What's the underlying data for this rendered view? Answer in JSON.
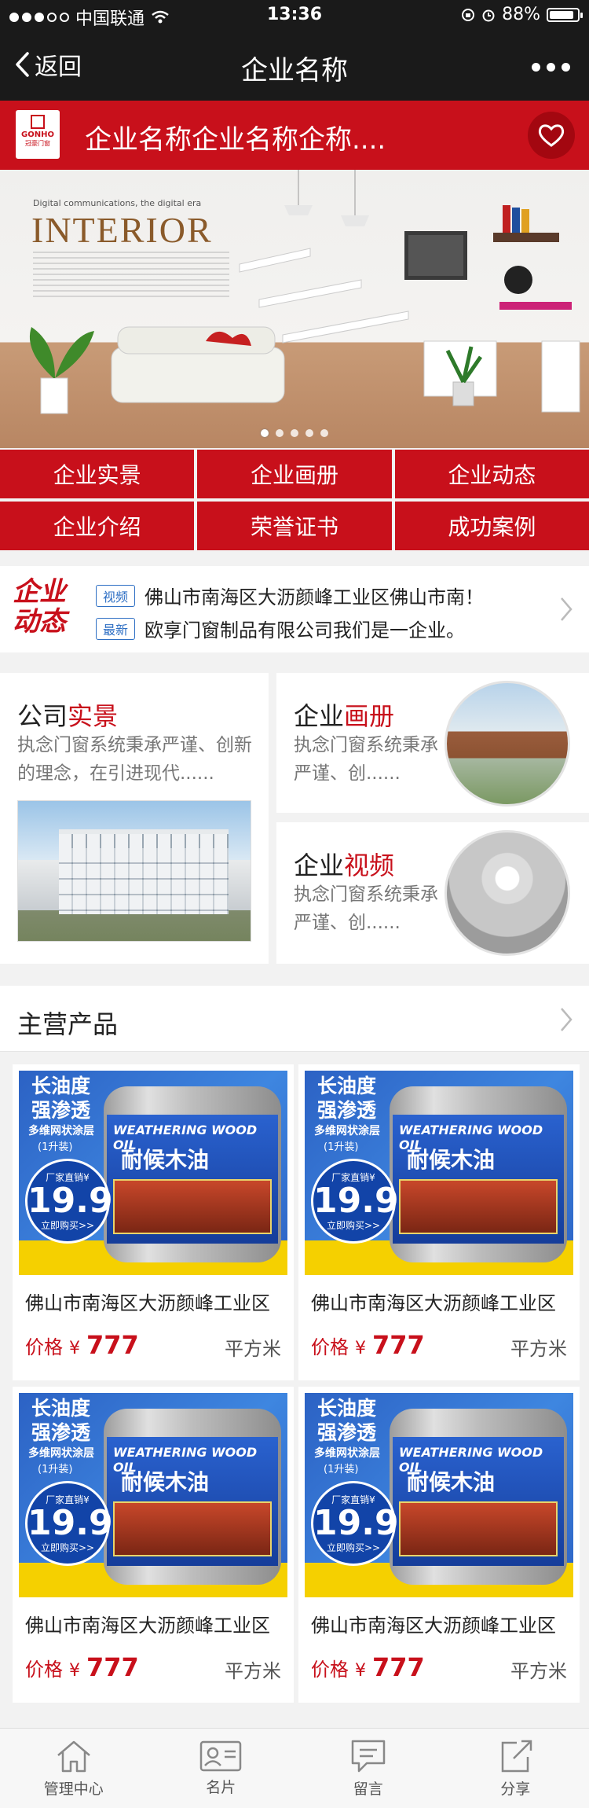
{
  "status_bar": {
    "carrier": "中国联通",
    "time": "13:36",
    "battery": "88%"
  },
  "nav": {
    "back_label": "返回",
    "title": "企业名称"
  },
  "company": {
    "logo_en": "GONHO",
    "logo_cn": "冠豪门窗",
    "name": "企业名称企业名称企称...."
  },
  "banner": {
    "tagline": "Digital communications, the digital era",
    "headline": "INTERIOR",
    "slides": 5,
    "active_slide": 0
  },
  "menu": {
    "items": [
      "企业实景",
      "企业画册",
      "企业动态",
      "企业介绍",
      "荣誉证书",
      "成功案例"
    ]
  },
  "news": {
    "brand_line1": "企业",
    "brand_line2": "动态",
    "rows": [
      {
        "badge": "视频",
        "text": "佛山市南海区大沥颜峰工业区佛山市南！"
      },
      {
        "badge": "最新",
        "text": "欧享门窗制品有限公司我们是一企业。"
      }
    ]
  },
  "features": {
    "scene": {
      "title_a": "公司",
      "title_b": "实景",
      "desc": "执念门窗系统秉承严谨、创新的理念，在引进现代......"
    },
    "album": {
      "title_a": "企业",
      "title_b": "画册",
      "desc": "执念门窗系统秉承严谨、创......"
    },
    "video": {
      "title_a": "企业",
      "title_b": "视频",
      "desc": "执念门窗系统秉承严谨、创......"
    }
  },
  "products": {
    "section_title": "主营产品",
    "promo": {
      "line1": "长油度",
      "line2": "强渗透",
      "line3": "多维网状涂层",
      "line4": "(1升装)",
      "bubble_top": "厂家直销¥",
      "bubble_price": "19.9",
      "bubble_bottom": "立即购买>>",
      "can_en": "WEATHERING WOOD OIL",
      "can_cn": "耐候木油"
    },
    "items": [
      {
        "name": "佛山市南海区大沥颜峰工业区",
        "price_label": "价格",
        "currency": "¥",
        "price": "777",
        "unit": "平方米"
      },
      {
        "name": "佛山市南海区大沥颜峰工业区",
        "price_label": "价格",
        "currency": "¥",
        "price": "777",
        "unit": "平方米"
      },
      {
        "name": "佛山市南海区大沥颜峰工业区",
        "price_label": "价格",
        "currency": "¥",
        "price": "777",
        "unit": "平方米"
      },
      {
        "name": "佛山市南海区大沥颜峰工业区",
        "price_label": "价格",
        "currency": "¥",
        "price": "777",
        "unit": "平方米"
      }
    ]
  },
  "tabbar": {
    "items": [
      {
        "label": "管理中心",
        "icon": "home-icon"
      },
      {
        "label": "名片",
        "icon": "card-icon"
      },
      {
        "label": "留言",
        "icon": "message-icon"
      },
      {
        "label": "分享",
        "icon": "share-icon"
      }
    ]
  },
  "colors": {
    "brand_red": "#c8101b",
    "bar_dark": "#1a1a1a",
    "badge_blue": "#2e6fc4"
  }
}
